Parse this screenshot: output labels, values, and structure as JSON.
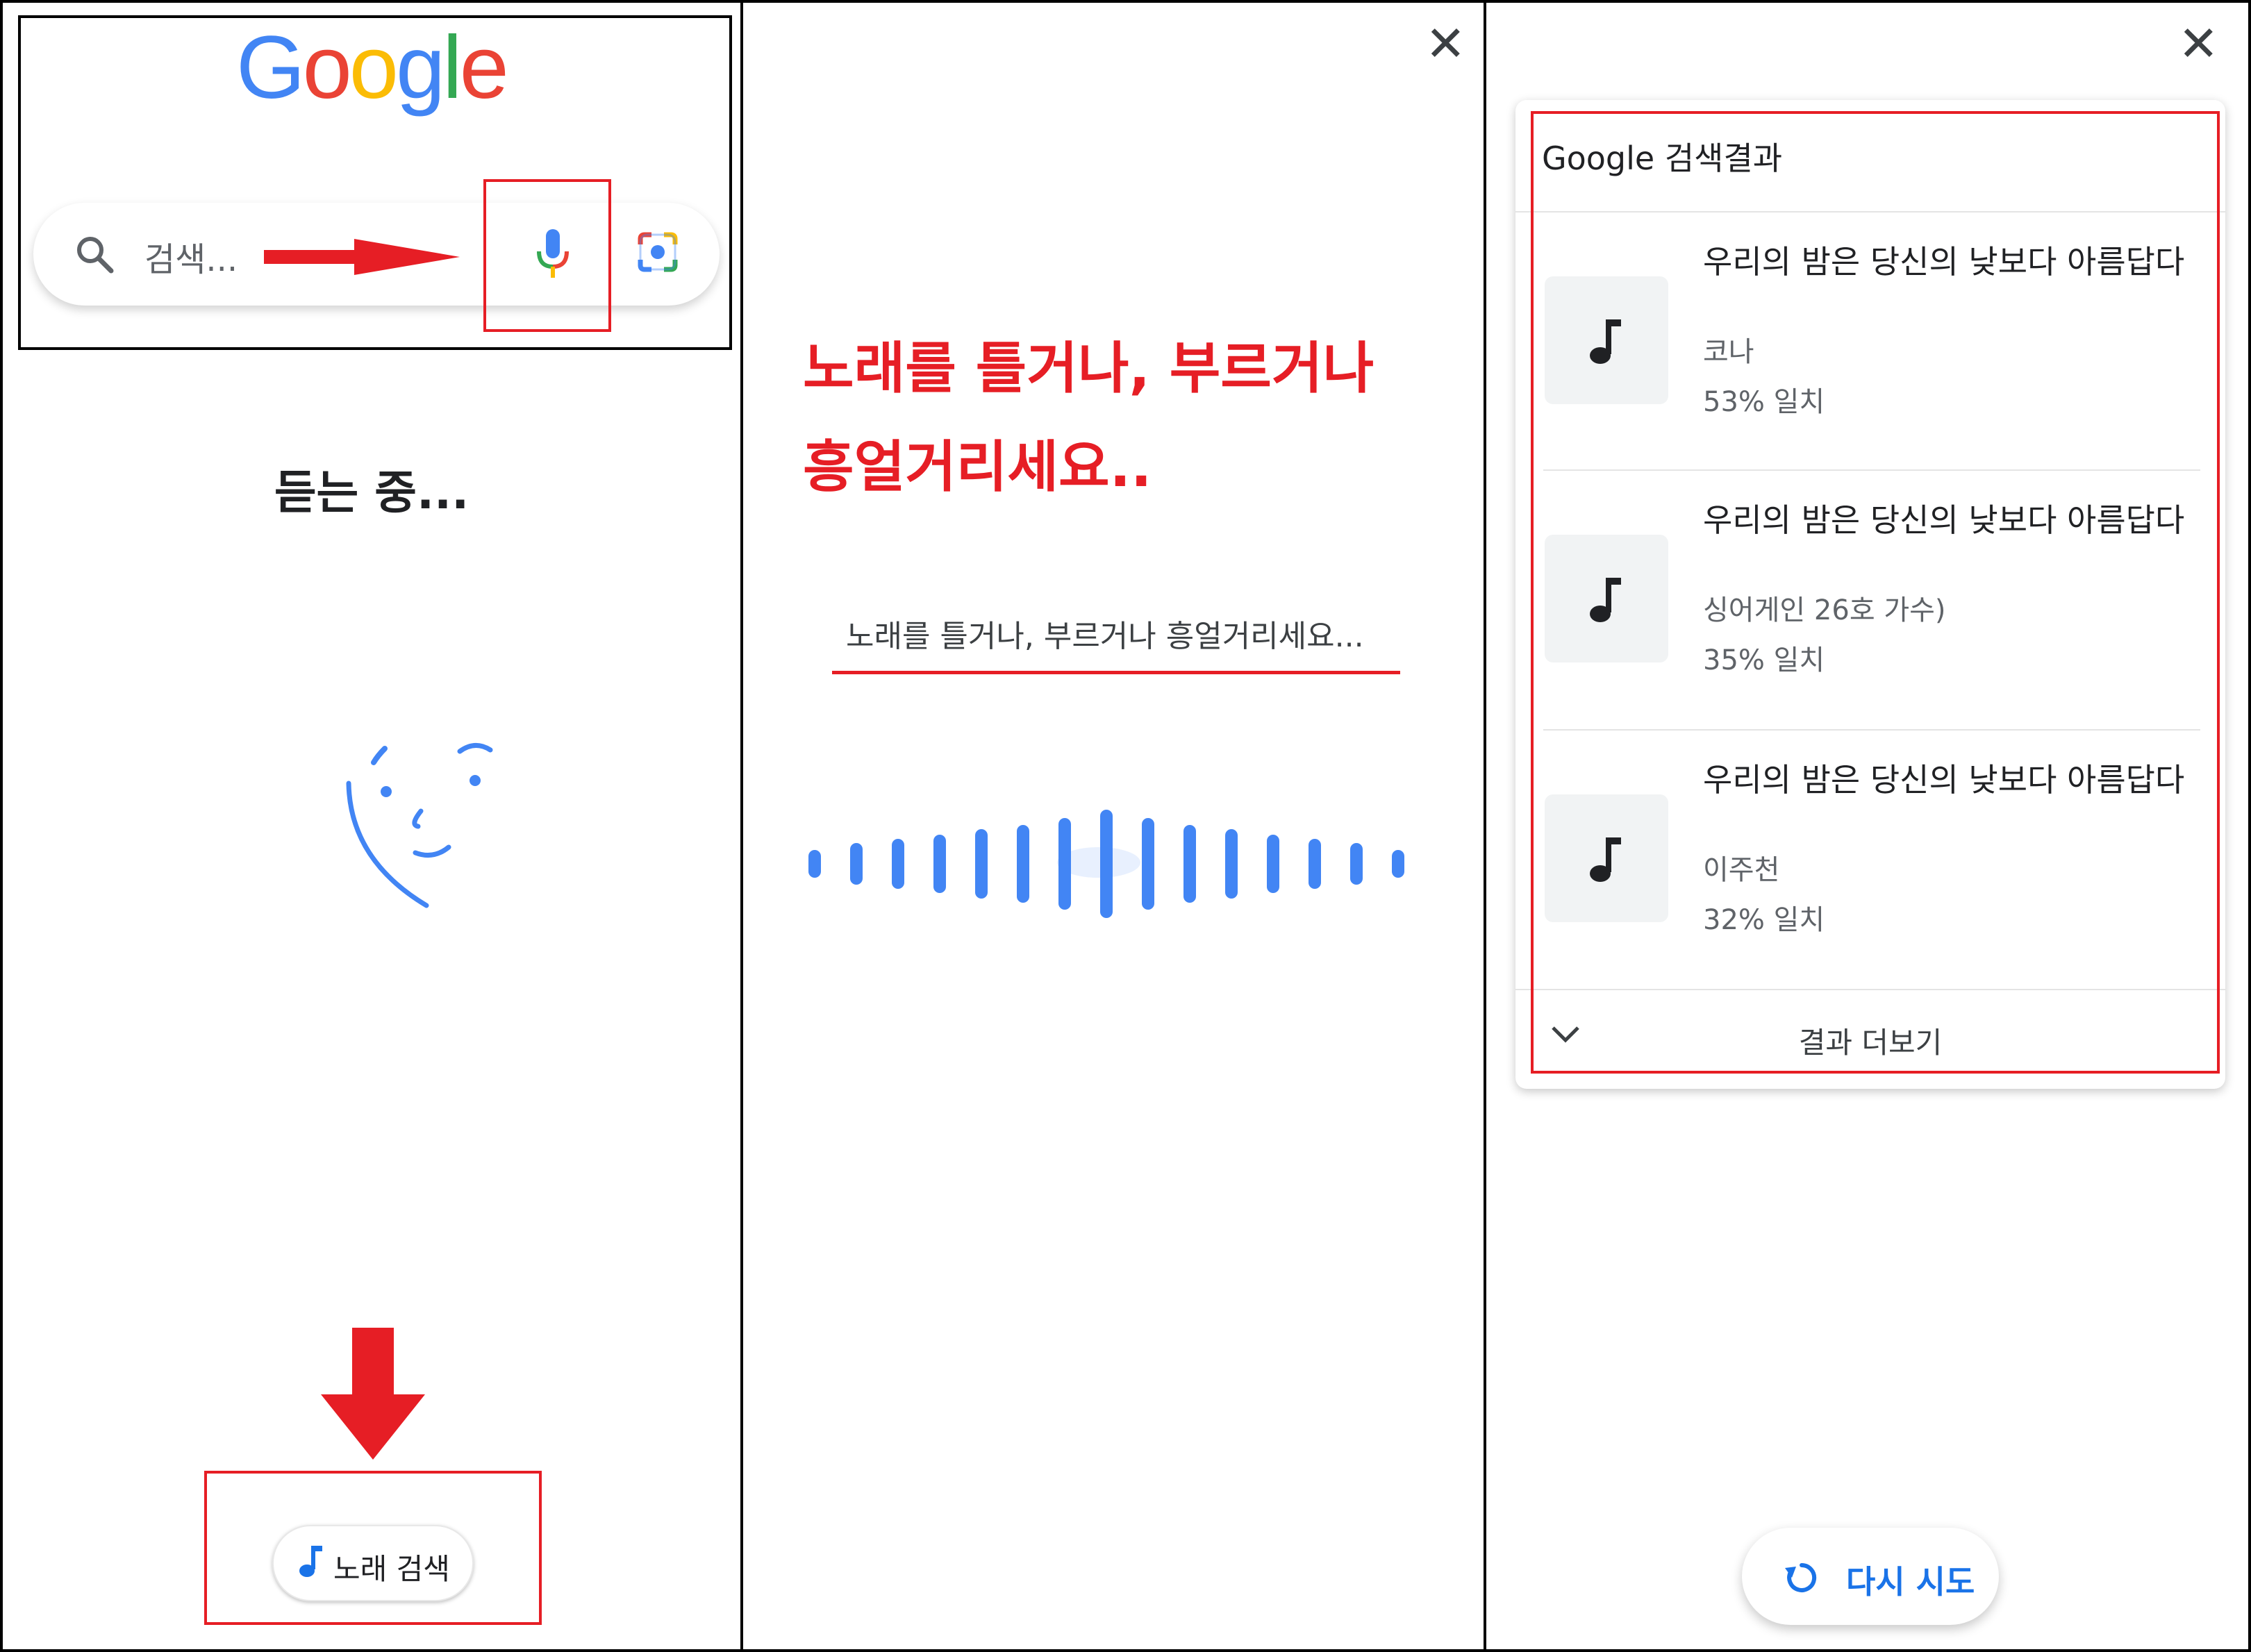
{
  "panel1": {
    "logo_letters": [
      {
        "ch": "G",
        "color": "#4285F4"
      },
      {
        "ch": "o",
        "color": "#EA4335"
      },
      {
        "ch": "o",
        "color": "#FBBC05"
      },
      {
        "ch": "g",
        "color": "#4285F4"
      },
      {
        "ch": "l",
        "color": "#34A853"
      },
      {
        "ch": "e",
        "color": "#EA4335"
      }
    ],
    "search_placeholder": "검색...",
    "listening_label": "듣는 중...",
    "song_search_label": "노래 검색"
  },
  "panel2": {
    "prompt_line1": "노래를 틀거나, 부르거나",
    "prompt_line2": "흥얼거리세요..",
    "prompt_small": "노래를 틀거나, 부르거나 흥얼거리세요..."
  },
  "panel3": {
    "card_title": "Google 검색결과",
    "results": [
      {
        "title": "우리의 밤은 당신의 낮보다 아름답다",
        "artist": "코나",
        "match": "53% 일치"
      },
      {
        "title": "우리의 밤은 당신의 낮보다 아름답다",
        "artist": "싱어게인 26호 가수)",
        "match": "35% 일치"
      },
      {
        "title": "우리의 밤은 당신의 낮보다 아름답다",
        "artist": "이주천",
        "match": "32% 일치"
      }
    ],
    "more_results_label": "결과 더보기",
    "retry_label": "다시 시도"
  },
  "colors": {
    "annotation_red": "#e61e25",
    "accent_blue": "#1a73e8",
    "wave_blue": "#4285F4"
  }
}
